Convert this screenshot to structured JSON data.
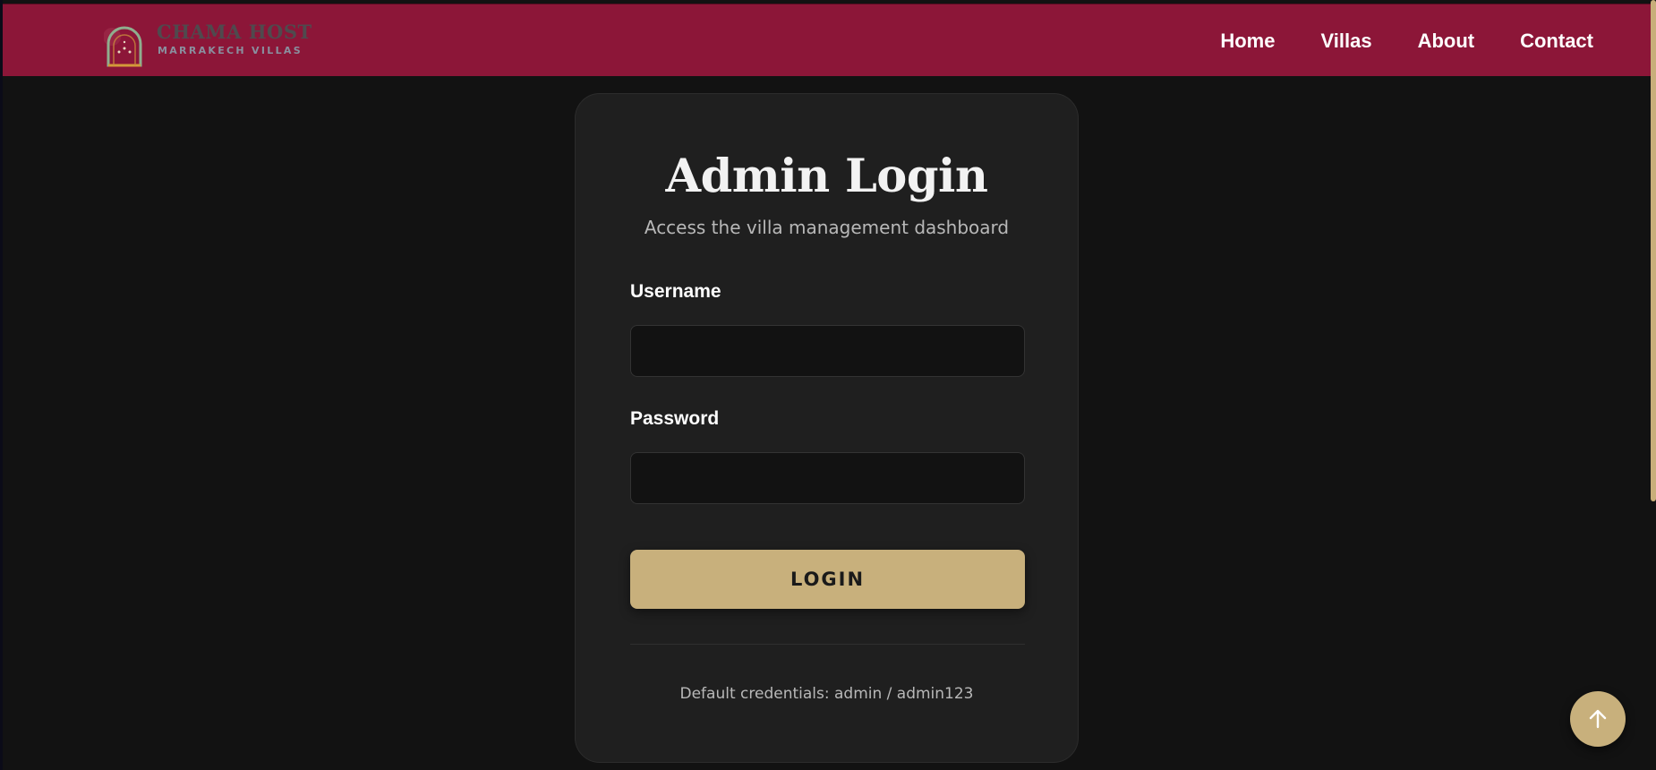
{
  "brand": {
    "name": "CHAMA HOST",
    "tagline": "MARRAKECH VILLAS",
    "icon": "arch-logo-icon"
  },
  "nav": {
    "items": [
      {
        "label": "Home"
      },
      {
        "label": "Villas"
      },
      {
        "label": "About"
      },
      {
        "label": "Contact"
      }
    ]
  },
  "login": {
    "title": "Admin Login",
    "subtitle": "Access the villa management dashboard",
    "username_label": "Username",
    "username_value": "",
    "password_label": "Password",
    "password_value": "",
    "button_label": "LOGIN",
    "note": "Default credentials: admin / admin123"
  },
  "scroll_top": {
    "icon": "arrow-up-icon"
  },
  "colors": {
    "header_bg": "#8c1638",
    "page_bg": "#121212",
    "card_bg": "#1f1f1f",
    "accent_gold": "#c8b07c"
  }
}
